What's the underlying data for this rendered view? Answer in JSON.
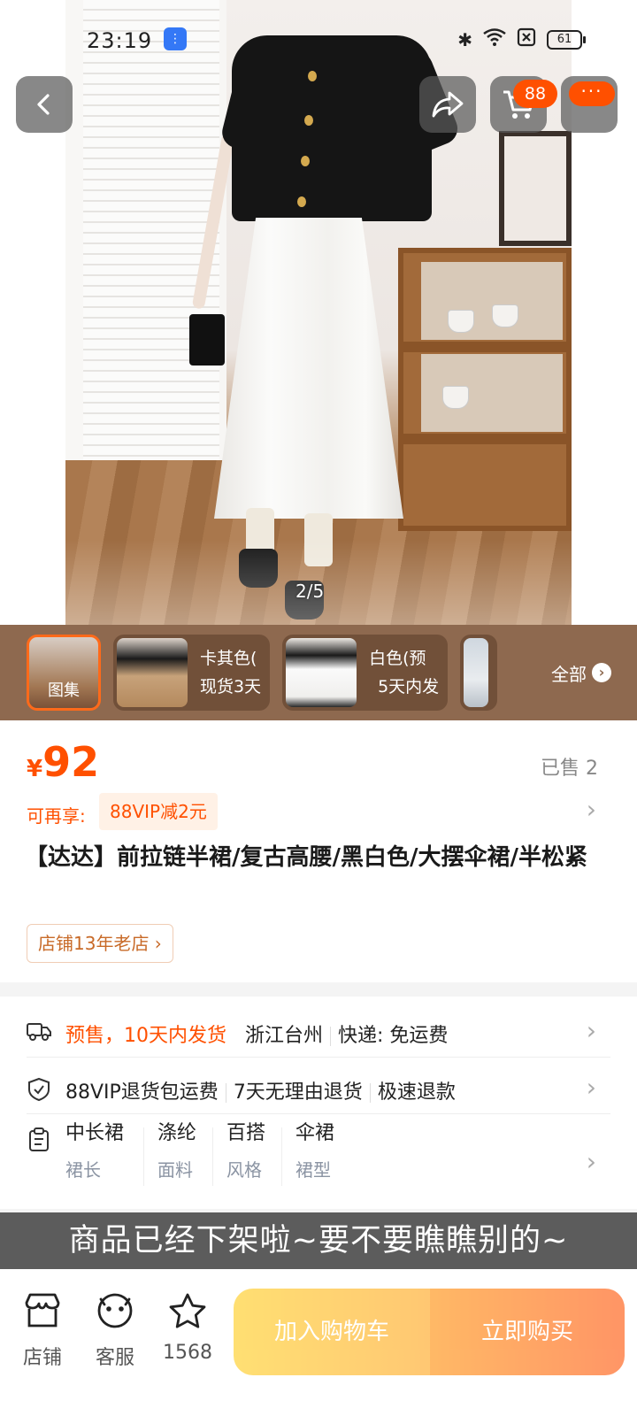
{
  "status_bar": {
    "time": "23:19",
    "battery": "61"
  },
  "gallery": {
    "page_indicator": "2/5",
    "cart_count": "88",
    "more_label": "···"
  },
  "thumbs": {
    "gallery_label": "图集",
    "variants": [
      {
        "line1": "卡其色(",
        "line2": "现货3天"
      },
      {
        "line1": "白色(预",
        "line2": "5天内发"
      }
    ],
    "all_label": "全部"
  },
  "price": {
    "currency": "¥",
    "value": "92",
    "sold": "已售 2"
  },
  "promo": {
    "label": "可再享:",
    "chip": "88VIP减2元"
  },
  "product": {
    "title": "【达达】前拉链半裙/复古高腰/黑白色/大摆伞裙/半松紧",
    "shop_tag": "店铺13年老店"
  },
  "shipping": {
    "presale": "预售，10天内发货",
    "origin": "浙江台州",
    "delivery": "快递: 免运费"
  },
  "guarantee": {
    "items": [
      "88VIP退货包运费",
      "7天无理由退货",
      "极速退款"
    ]
  },
  "attributes": [
    {
      "value": "中长裙",
      "key": "裙长"
    },
    {
      "value": "涤纶",
      "key": "面料"
    },
    {
      "value": "百搭",
      "key": "风格"
    },
    {
      "value": "伞裙",
      "key": "裙型"
    }
  ],
  "banner": {
    "offshelf": "商品已经下架啦~要不要瞧瞧别的~"
  },
  "bottom_bar": {
    "store_label": "店铺",
    "service_label": "客服",
    "favorite_count": "1568",
    "add_cart": "加入购物车",
    "buy_now": "立即购买"
  },
  "colors": {
    "accent": "#ff5000",
    "banner_bg": "#5c5c5c",
    "thumb_strip_bg": "#8e694f"
  },
  "icons": [
    "back-icon",
    "share-icon",
    "cart-icon",
    "more-icon",
    "truck-icon",
    "shield-check-icon",
    "clipboard-icon",
    "store-icon",
    "chat-icon",
    "star-icon",
    "chevron-right-icon"
  ]
}
